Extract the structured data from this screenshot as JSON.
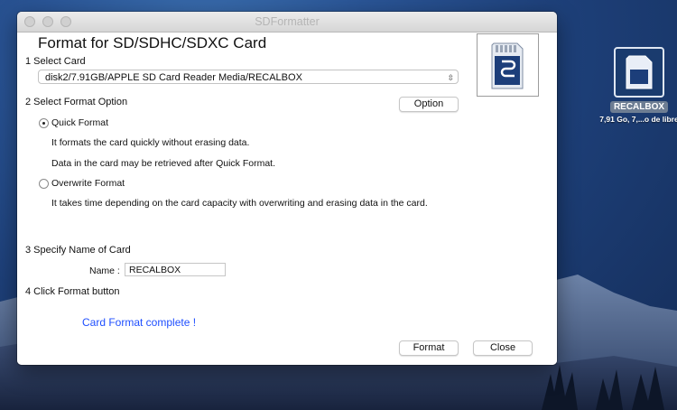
{
  "window": {
    "title": "SDFormatter"
  },
  "header": {
    "title": "Format for SD/SDHC/SDXC Card"
  },
  "step1": {
    "label": "1 Select Card",
    "selected_card": "disk2/7.91GB/APPLE SD Card Reader Media/RECALBOX"
  },
  "step2": {
    "label": "2 Select Format Option",
    "option_button": "Option",
    "quick": {
      "label": "Quick Format",
      "selected": true,
      "desc1": "It formats the card quickly without erasing data.",
      "desc2": "Data in the card may be retrieved after Quick Format."
    },
    "overwrite": {
      "label": "Overwrite Format",
      "selected": false,
      "desc": "It takes time depending on the card capacity with overwriting and erasing data in the card."
    }
  },
  "step3": {
    "label": "3 Specify Name of Card",
    "name_label": "Name :",
    "name_value": "RECALBOX"
  },
  "step4": {
    "label": "4 Click Format button"
  },
  "status": {
    "message": "Card Format complete !"
  },
  "buttons": {
    "format": "Format",
    "close": "Close"
  },
  "desktop_icon": {
    "name": "RECALBOX",
    "subtitle": "7,91 Go, 7,...o de libre",
    "icon": "sd-card-icon"
  },
  "colors": {
    "status_text": "#1f4fff",
    "sd_card_blue": "#1c3e7a",
    "desktop_bg": "#1d3f78"
  }
}
